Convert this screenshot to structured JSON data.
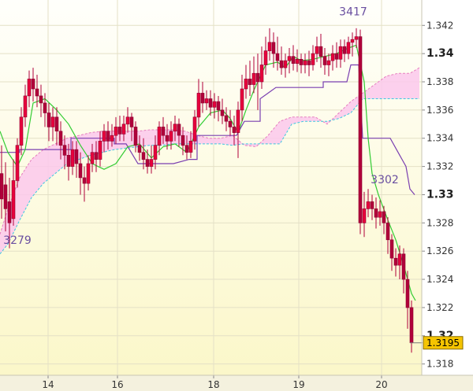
{
  "chart_data": {
    "type": "candlestick",
    "ylim": [
      1.3172,
      1.3438
    ],
    "xlim": [
      0,
      530
    ],
    "grid": true,
    "y_ticks": [
      {
        "value": 1.342,
        "label": "1.342",
        "bold": false
      },
      {
        "value": 1.34,
        "label": "1.34",
        "bold": true
      },
      {
        "value": 1.338,
        "label": "1.338",
        "bold": false
      },
      {
        "value": 1.336,
        "label": "1.336",
        "bold": false
      },
      {
        "value": 1.334,
        "label": "1.334",
        "bold": false
      },
      {
        "value": 1.332,
        "label": "1.332",
        "bold": false
      },
      {
        "value": 1.33,
        "label": "1.33",
        "bold": true
      },
      {
        "value": 1.328,
        "label": "1.328",
        "bold": false
      },
      {
        "value": 1.326,
        "label": "1.326",
        "bold": false
      },
      {
        "value": 1.324,
        "label": "1.324",
        "bold": false
      },
      {
        "value": 1.322,
        "label": "1.322",
        "bold": false
      },
      {
        "value": 1.32,
        "label": "1.32",
        "bold": true
      },
      {
        "value": 1.318,
        "label": "1.318",
        "bold": false
      }
    ],
    "x_ticks": [
      {
        "value": 61,
        "label": "14"
      },
      {
        "value": 149,
        "label": "16"
      },
      {
        "value": 271,
        "label": "18"
      },
      {
        "value": 379,
        "label": "19"
      },
      {
        "value": 484,
        "label": "20"
      }
    ],
    "last_price": {
      "value": 1.3195,
      "label": "1.3195"
    },
    "annotations": [
      {
        "label": "3417",
        "x": 448,
        "y": 1.3427
      },
      {
        "label": "3302",
        "x": 488,
        "y": 1.3308
      },
      {
        "label": "3279",
        "x": 22,
        "y": 1.3265
      }
    ],
    "candles": [
      [
        2,
        1.3315,
        1.3297,
        1.3335,
        1.3283
      ],
      [
        7,
        1.3307,
        1.329,
        1.3323,
        1.3274
      ],
      [
        12,
        1.3295,
        1.328,
        1.3312,
        1.3262
      ],
      [
        17,
        1.3283,
        1.331,
        1.3325,
        1.3278
      ],
      [
        22,
        1.331,
        1.3335,
        1.334,
        1.3305
      ],
      [
        27,
        1.3335,
        1.3355,
        1.3362,
        1.3328
      ],
      [
        32,
        1.3355,
        1.337,
        1.3378,
        1.3348
      ],
      [
        37,
        1.337,
        1.3382,
        1.3388,
        1.3362
      ],
      [
        42,
        1.3382,
        1.3375,
        1.339,
        1.3366
      ],
      [
        47,
        1.3375,
        1.337,
        1.3385,
        1.3362
      ],
      [
        52,
        1.337,
        1.3365,
        1.3378,
        1.3355
      ],
      [
        57,
        1.3365,
        1.3358,
        1.3372,
        1.3348
      ],
      [
        62,
        1.3358,
        1.3348,
        1.3365,
        1.3338
      ],
      [
        67,
        1.3348,
        1.3355,
        1.3362,
        1.3338
      ],
      [
        72,
        1.3355,
        1.3345,
        1.3362,
        1.3335
      ],
      [
        77,
        1.3345,
        1.3335,
        1.3352,
        1.3325
      ],
      [
        82,
        1.3335,
        1.3328,
        1.3342,
        1.3318
      ],
      [
        87,
        1.3328,
        1.332,
        1.3336,
        1.331
      ],
      [
        92,
        1.332,
        1.3332,
        1.3338,
        1.3314
      ],
      [
        97,
        1.3332,
        1.3322,
        1.3338,
        1.3312
      ],
      [
        102,
        1.3322,
        1.3312,
        1.333,
        1.33
      ],
      [
        107,
        1.3312,
        1.3308,
        1.332,
        1.3295
      ],
      [
        112,
        1.3308,
        1.3322,
        1.3328,
        1.3303
      ],
      [
        117,
        1.3322,
        1.333,
        1.3336,
        1.3316
      ],
      [
        122,
        1.333,
        1.3325,
        1.3338,
        1.3316
      ],
      [
        127,
        1.3325,
        1.3338,
        1.3345,
        1.332
      ],
      [
        132,
        1.3338,
        1.3345,
        1.335,
        1.333
      ],
      [
        137,
        1.3345,
        1.3338,
        1.3352,
        1.3332
      ],
      [
        142,
        1.3338,
        1.3342,
        1.335,
        1.3334
      ],
      [
        147,
        1.3342,
        1.3348,
        1.3355,
        1.3336
      ],
      [
        152,
        1.3348,
        1.3343,
        1.3356,
        1.3338
      ],
      [
        157,
        1.3343,
        1.335,
        1.3356,
        1.3338
      ],
      [
        162,
        1.335,
        1.3355,
        1.3362,
        1.3344
      ],
      [
        167,
        1.3355,
        1.3348,
        1.3358,
        1.3338
      ],
      [
        172,
        1.3348,
        1.3335,
        1.3352,
        1.333
      ],
      [
        177,
        1.3335,
        1.333,
        1.3342,
        1.3324
      ],
      [
        182,
        1.333,
        1.3325,
        1.334,
        1.3318
      ],
      [
        187,
        1.3325,
        1.332,
        1.3332,
        1.3315
      ],
      [
        192,
        1.332,
        1.3325,
        1.3335,
        1.3315
      ],
      [
        197,
        1.3325,
        1.3335,
        1.3342,
        1.3318
      ],
      [
        202,
        1.3335,
        1.3348,
        1.3352,
        1.3328
      ],
      [
        207,
        1.3348,
        1.3342,
        1.3355,
        1.3336
      ],
      [
        212,
        1.3342,
        1.3338,
        1.335,
        1.3332
      ],
      [
        217,
        1.3338,
        1.3345,
        1.3352,
        1.3332
      ],
      [
        222,
        1.3345,
        1.335,
        1.3356,
        1.3338
      ],
      [
        227,
        1.335,
        1.3342,
        1.3354,
        1.3334
      ],
      [
        232,
        1.3342,
        1.3335,
        1.3348,
        1.3328
      ],
      [
        237,
        1.3335,
        1.333,
        1.3342,
        1.3325
      ],
      [
        242,
        1.333,
        1.3338,
        1.3345,
        1.3326
      ],
      [
        247,
        1.3338,
        1.3355,
        1.336,
        1.3332
      ],
      [
        252,
        1.3355,
        1.3372,
        1.3382,
        1.3348
      ],
      [
        257,
        1.3372,
        1.3365,
        1.338,
        1.3358
      ],
      [
        262,
        1.3365,
        1.3368,
        1.3374,
        1.336
      ],
      [
        267,
        1.3368,
        1.3362,
        1.3374,
        1.3356
      ],
      [
        272,
        1.3362,
        1.3366,
        1.3372,
        1.3354
      ],
      [
        277,
        1.3366,
        1.336,
        1.337,
        1.3352
      ],
      [
        282,
        1.336,
        1.3356,
        1.3368,
        1.335
      ],
      [
        287,
        1.3356,
        1.3352,
        1.3362,
        1.3345
      ],
      [
        292,
        1.3352,
        1.3348,
        1.336,
        1.3342
      ],
      [
        297,
        1.3348,
        1.3344,
        1.3356,
        1.3335
      ],
      [
        302,
        1.3344,
        1.336,
        1.3366,
        1.3326
      ],
      [
        307,
        1.336,
        1.3375,
        1.3385,
        1.3352
      ],
      [
        312,
        1.3375,
        1.3382,
        1.3392,
        1.3368
      ],
      [
        317,
        1.3382,
        1.3378,
        1.3395,
        1.337
      ],
      [
        322,
        1.3378,
        1.3386,
        1.3398,
        1.3372
      ],
      [
        327,
        1.3386,
        1.338,
        1.34,
        1.336
      ],
      [
        332,
        1.338,
        1.3392,
        1.3405,
        1.3375
      ],
      [
        337,
        1.3392,
        1.3402,
        1.3412,
        1.3385
      ],
      [
        342,
        1.3402,
        1.3408,
        1.3418,
        1.3395
      ],
      [
        347,
        1.3408,
        1.34,
        1.3415,
        1.339
      ],
      [
        352,
        1.34,
        1.3395,
        1.3412,
        1.3388
      ],
      [
        357,
        1.3395,
        1.339,
        1.3405,
        1.3385
      ],
      [
        362,
        1.339,
        1.3395,
        1.34,
        1.3383
      ],
      [
        367,
        1.3395,
        1.3398,
        1.3404,
        1.3386
      ],
      [
        372,
        1.3398,
        1.3393,
        1.3406,
        1.3388
      ],
      [
        377,
        1.3393,
        1.3396,
        1.3403,
        1.3387
      ],
      [
        382,
        1.3396,
        1.3392,
        1.34,
        1.3386
      ],
      [
        387,
        1.3392,
        1.3395,
        1.34,
        1.3386
      ],
      [
        392,
        1.3395,
        1.3392,
        1.3402,
        1.3384
      ],
      [
        397,
        1.3392,
        1.34,
        1.3406,
        1.3388
      ],
      [
        402,
        1.34,
        1.3405,
        1.3412,
        1.3394
      ],
      [
        407,
        1.3405,
        1.3398,
        1.3414,
        1.339
      ],
      [
        412,
        1.3398,
        1.3392,
        1.3404,
        1.3385
      ],
      [
        417,
        1.3392,
        1.3395,
        1.34,
        1.3384
      ],
      [
        422,
        1.3395,
        1.34,
        1.3406,
        1.3388
      ],
      [
        427,
        1.34,
        1.3396,
        1.3408,
        1.339
      ],
      [
        432,
        1.3396,
        1.3405,
        1.341,
        1.339
      ],
      [
        437,
        1.3405,
        1.34,
        1.341,
        1.3394
      ],
      [
        442,
        1.34,
        1.3408,
        1.3412,
        1.3396
      ],
      [
        447,
        1.3408,
        1.341,
        1.3415,
        1.3398
      ],
      [
        452,
        1.341,
        1.3412,
        1.3418,
        1.3404
      ],
      [
        457,
        1.3412,
        1.328,
        1.3417,
        1.3272
      ],
      [
        462,
        1.328,
        1.329,
        1.3302,
        1.327
      ],
      [
        467,
        1.329,
        1.3295,
        1.3304,
        1.3284
      ],
      [
        472,
        1.3295,
        1.329,
        1.33,
        1.3282
      ],
      [
        477,
        1.329,
        1.3284,
        1.3298,
        1.3276
      ],
      [
        482,
        1.3284,
        1.3288,
        1.3296,
        1.3278
      ],
      [
        487,
        1.3288,
        1.328,
        1.3292,
        1.3272
      ],
      [
        492,
        1.328,
        1.3268,
        1.3284,
        1.3258
      ],
      [
        497,
        1.3268,
        1.3255,
        1.3272,
        1.3246
      ],
      [
        502,
        1.3255,
        1.325,
        1.3262,
        1.3242
      ],
      [
        507,
        1.325,
        1.3258,
        1.3264,
        1.324
      ],
      [
        512,
        1.3258,
        1.324,
        1.3262,
        1.323
      ],
      [
        517,
        1.324,
        1.322,
        1.3246,
        1.3205
      ],
      [
        522,
        1.322,
        1.3195,
        1.3225,
        1.3188
      ]
    ],
    "cloud": {
      "x": [
        0,
        10,
        25,
        40,
        55,
        70,
        85,
        100,
        115,
        130,
        145,
        160,
        175,
        190,
        205,
        220,
        235,
        250,
        265,
        280,
        295,
        310,
        325,
        340,
        355,
        370,
        385,
        400,
        415,
        430,
        445,
        460,
        475,
        490,
        505,
        520,
        532
      ],
      "a": [
        1.3272,
        1.329,
        1.3312,
        1.3325,
        1.3332,
        1.3336,
        1.334,
        1.3342,
        1.3344,
        1.3345,
        1.3345,
        1.3345,
        1.3345,
        1.3346,
        1.3346,
        1.3346,
        1.3345,
        1.3342,
        1.334,
        1.334,
        1.3342,
        1.3335,
        1.3334,
        1.3342,
        1.3352,
        1.3355,
        1.3355,
        1.3355,
        1.335,
        1.3358,
        1.3366,
        1.3372,
        1.3378,
        1.3384,
        1.3386,
        1.3386,
        1.339
      ],
      "b": [
        1.3258,
        1.3265,
        1.3282,
        1.3298,
        1.3308,
        1.3315,
        1.3322,
        1.3325,
        1.3328,
        1.333,
        1.3332,
        1.3333,
        1.3334,
        1.3335,
        1.3335,
        1.3336,
        1.3336,
        1.3336,
        1.3336,
        1.3336,
        1.3335,
        1.3336,
        1.3336,
        1.3336,
        1.3336,
        1.335,
        1.3352,
        1.3352,
        1.3352,
        1.3354,
        1.3358,
        1.3368,
        1.3368,
        1.3368,
        1.3368,
        1.3368,
        1.3368
      ]
    },
    "kijun": [
      [
        0,
        1.333
      ],
      [
        25,
        1.333
      ],
      [
        25,
        1.3332
      ],
      [
        90,
        1.3332
      ],
      [
        90,
        1.334
      ],
      [
        145,
        1.334
      ],
      [
        145,
        1.3336
      ],
      [
        160,
        1.3336
      ],
      [
        175,
        1.3322
      ],
      [
        200,
        1.3322
      ],
      [
        220,
        1.3322
      ],
      [
        240,
        1.3325
      ],
      [
        250,
        1.3325
      ],
      [
        250,
        1.3342
      ],
      [
        290,
        1.3342
      ],
      [
        300,
        1.3342
      ],
      [
        310,
        1.3352
      ],
      [
        330,
        1.3352
      ],
      [
        330,
        1.3368
      ],
      [
        340,
        1.3372
      ],
      [
        350,
        1.3376
      ],
      [
        410,
        1.3376
      ],
      [
        410,
        1.338
      ],
      [
        440,
        1.338
      ],
      [
        445,
        1.3392
      ],
      [
        455,
        1.3392
      ],
      [
        460,
        1.334
      ],
      [
        495,
        1.334
      ],
      [
        505,
        1.333
      ],
      [
        515,
        1.332
      ],
      [
        520,
        1.3304
      ],
      [
        526,
        1.33
      ]
    ],
    "tenkan": [
      [
        0,
        1.3345
      ],
      [
        10,
        1.333
      ],
      [
        22,
        1.332
      ],
      [
        32,
        1.3332
      ],
      [
        42,
        1.3365
      ],
      [
        57,
        1.3368
      ],
      [
        72,
        1.336
      ],
      [
        87,
        1.335
      ],
      [
        102,
        1.3335
      ],
      [
        117,
        1.3322
      ],
      [
        132,
        1.3318
      ],
      [
        147,
        1.3322
      ],
      [
        162,
        1.3334
      ],
      [
        177,
        1.3336
      ],
      [
        192,
        1.3326
      ],
      [
        207,
        1.3334
      ],
      [
        222,
        1.3336
      ],
      [
        237,
        1.333
      ],
      [
        252,
        1.3348
      ],
      [
        267,
        1.3358
      ],
      [
        282,
        1.336
      ],
      [
        292,
        1.3354
      ],
      [
        302,
        1.3344
      ],
      [
        312,
        1.336
      ],
      [
        322,
        1.3374
      ],
      [
        337,
        1.3392
      ],
      [
        352,
        1.3394
      ],
      [
        362,
        1.339
      ],
      [
        372,
        1.3398
      ],
      [
        382,
        1.3395
      ],
      [
        397,
        1.3396
      ],
      [
        412,
        1.3398
      ],
      [
        427,
        1.34
      ],
      [
        442,
        1.3404
      ],
      [
        452,
        1.3406
      ],
      [
        462,
        1.338
      ],
      [
        467,
        1.334
      ],
      [
        472,
        1.3315
      ],
      [
        480,
        1.33
      ],
      [
        492,
        1.3282
      ],
      [
        502,
        1.3268
      ],
      [
        512,
        1.325
      ],
      [
        522,
        1.323
      ],
      [
        527,
        1.3225
      ]
    ]
  }
}
